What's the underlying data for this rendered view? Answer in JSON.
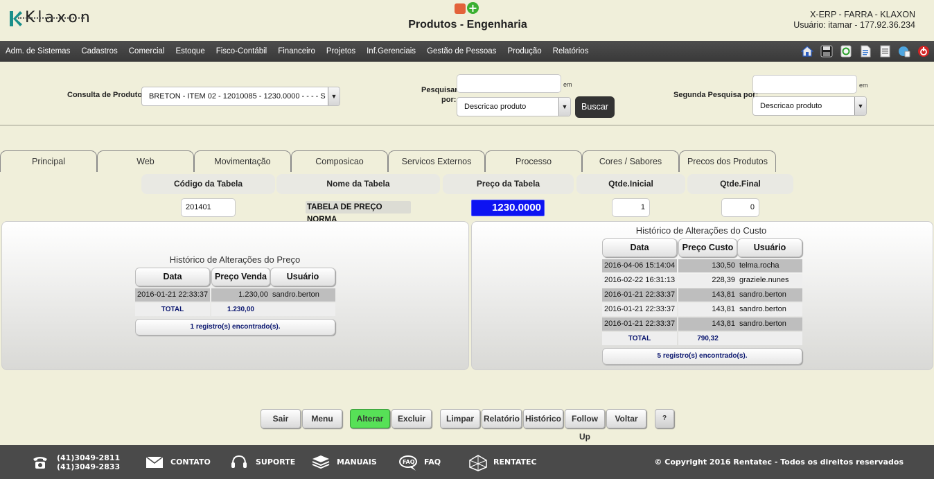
{
  "header": {
    "logo_text": "Klaxon",
    "page_title": "Produtos - Engenharia",
    "system_line": "X-ERP - FARRA - KLAXON",
    "user_line": "Usuário: itamar - 177.92.36.234"
  },
  "menu": {
    "items": [
      "Adm. de Sistemas",
      "Cadastros",
      "Comercial",
      "Estoque",
      "Fisco-Contábil",
      "Financeiro",
      "Projetos",
      "Inf.Gerenciais",
      "Gestão de Pessoas",
      "Produção",
      "Relatórios"
    ],
    "toolbar_icons": [
      "home-icon",
      "save-icon",
      "recycle-icon",
      "document-icon",
      "report-icon",
      "help-globe-icon",
      "power-icon"
    ]
  },
  "search": {
    "consulta_label": "Consulta de Produtos",
    "consulta_value": "BRETON - ITEM 02 - 12010085 - 1230.0000 - - - - S",
    "pesquisar_label_1": "Pesquisar",
    "pesquisar_label_2": "por:",
    "pesquisar_input": "",
    "em_label": "em",
    "pesquisar_field": "Descricao produto",
    "buscar_label": "Buscar",
    "segunda_label": "Segunda Pesquisa por:",
    "segunda_input": "",
    "segunda_field": "Descricao produto"
  },
  "tabs": [
    "Principal",
    "Web",
    "Movimentação",
    "Composicao",
    "Servicos Externos",
    "Processo",
    "Cores / Sabores",
    "Precos dos Produtos"
  ],
  "price_table": {
    "headers": {
      "codigo": "Código da Tabela",
      "nome": "Nome da Tabela",
      "preco": "Preço da Tabela",
      "qtde_inicial": "Qtde.Inicial",
      "qtde_final": "Qtde.Final"
    },
    "values": {
      "codigo": "201401",
      "nome": "TABELA DE PREÇO NORMA",
      "preco": "1230.0000",
      "qtde_inicial": "1",
      "qtde_final": "0"
    }
  },
  "price_history": {
    "title": "Histórico de Alterações do Preço",
    "columns": [
      "Data",
      "Preço Venda",
      "Usuário"
    ],
    "rows": [
      {
        "data": "2016-01-21 22:33:37",
        "valor": "1.230,00",
        "usuario": "sandro.berton"
      }
    ],
    "total_label": "TOTAL",
    "total_value": "1.230,00",
    "footer": "1 registro(s) encontrado(s)."
  },
  "cost_history": {
    "title": "Histórico de Alterações do Custo",
    "columns": [
      "Data",
      "Preço Custo",
      "Usuário"
    ],
    "rows": [
      {
        "data": "2016-04-06 15:14:04",
        "valor": "130,50",
        "usuario": "telma.rocha"
      },
      {
        "data": "2016-02-22 16:31:13",
        "valor": "228,39",
        "usuario": "graziele.nunes"
      },
      {
        "data": "2016-01-21 22:33:37",
        "valor": "143,81",
        "usuario": "sandro.berton"
      },
      {
        "data": "2016-01-21 22:33:37",
        "valor": "143,81",
        "usuario": "sandro.berton"
      },
      {
        "data": "2016-01-21 22:33:37",
        "valor": "143,81",
        "usuario": "sandro.berton"
      }
    ],
    "total_label": "TOTAL",
    "total_value": "790,32",
    "footer": "5 registro(s) encontrado(s)."
  },
  "actions": {
    "sair": "Sair",
    "menu": "Menu",
    "alterar": "Alterar",
    "excluir": "Excluir",
    "limpar": "Limpar",
    "relatorio": "Relatório",
    "historico": "Histórico",
    "followup": "Follow Up",
    "voltar": "Voltar",
    "help": "?"
  },
  "footer": {
    "phone_1": "(41)3049-2811",
    "phone_2": "(41)3049-2833",
    "contato": "CONTATO",
    "suporte": "SUPORTE",
    "manuais": "MANUAIS",
    "faq": "FAQ",
    "rentatec": "RENTATEC",
    "copyright": "© Copyright 2016 Rentatec - Todos os direitos reservados"
  },
  "colors": {
    "background": "#f0efda",
    "menubar": "#454545",
    "price_highlight": "#0d13f2",
    "alterar_button": "#57e157",
    "footer": "#4a4a4a"
  }
}
